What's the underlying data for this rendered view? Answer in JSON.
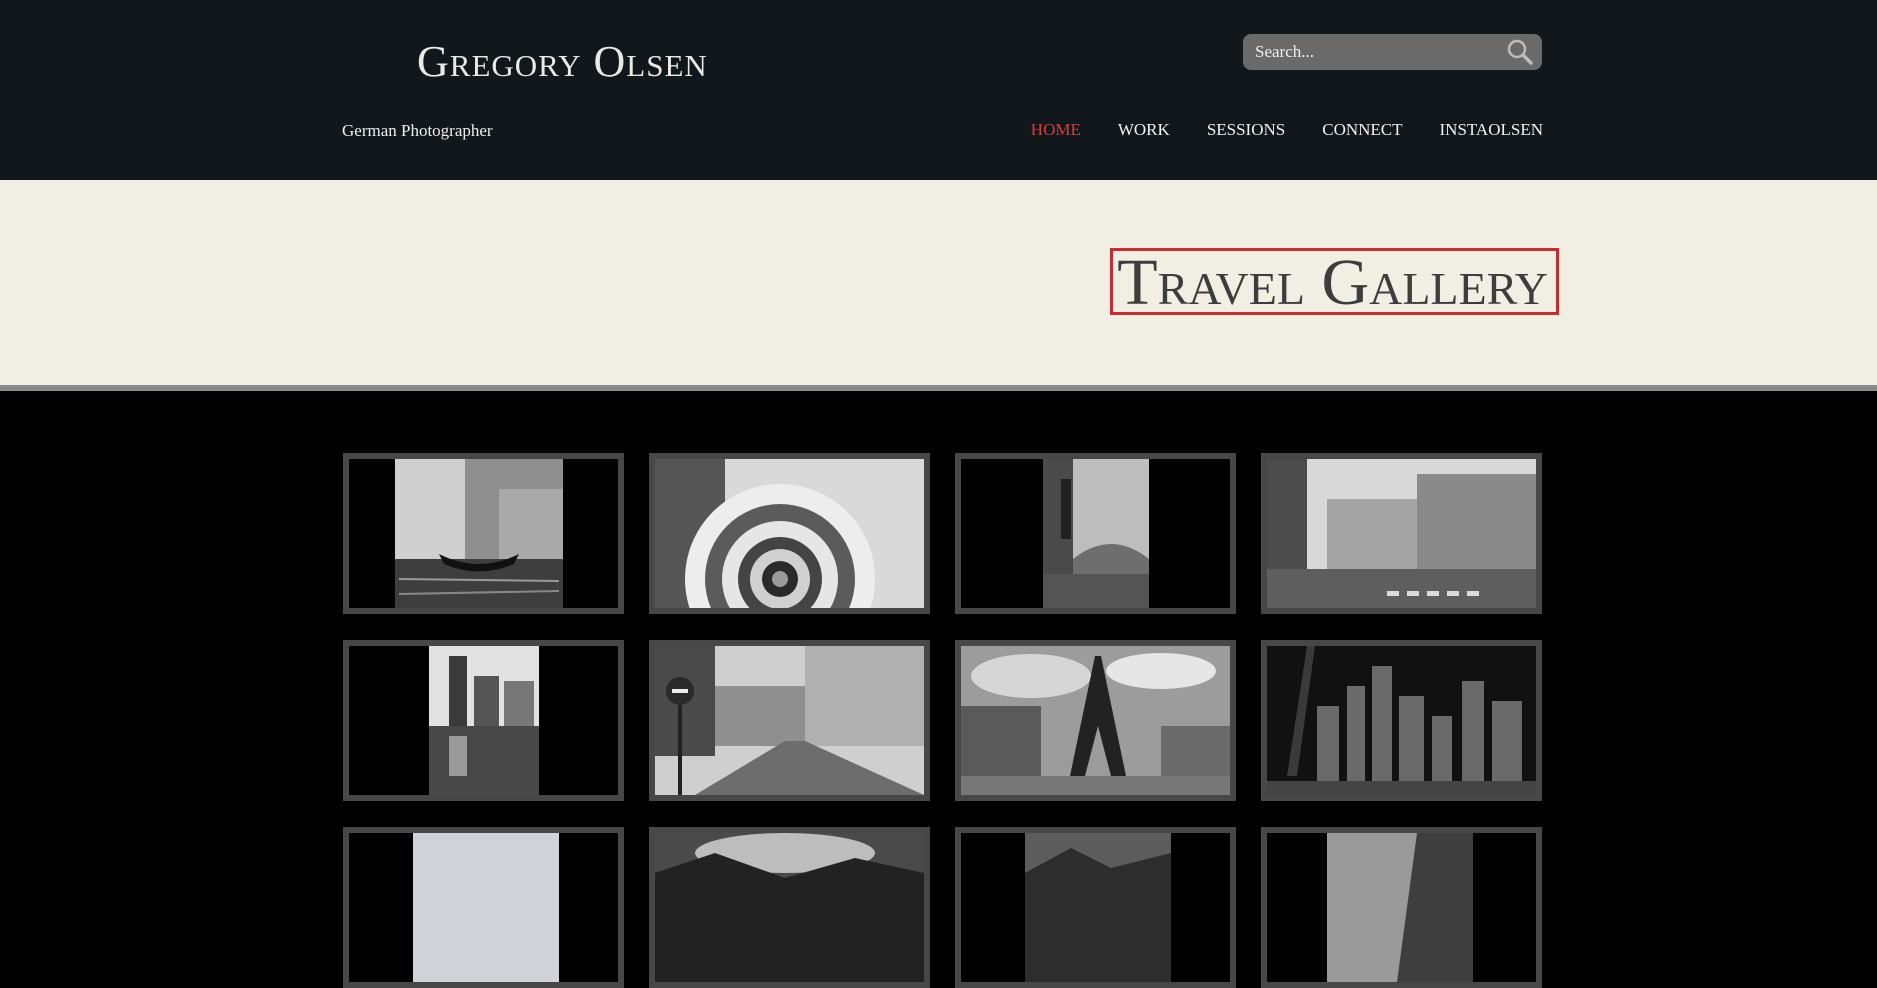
{
  "header": {
    "site_title": "Gregory Olsen",
    "tagline": "German Photographer",
    "search_placeholder": "Search...",
    "nav": [
      {
        "label": "HOME",
        "active": true
      },
      {
        "label": "WORK",
        "active": false
      },
      {
        "label": "SESSIONS",
        "active": false
      },
      {
        "label": "CONNECT",
        "active": false
      },
      {
        "label": "INSTAOLSEN",
        "active": false
      }
    ]
  },
  "banner": {
    "title": "Travel Gallery"
  },
  "gallery": {
    "thumbnails": [
      {
        "subject": "venice-canal-gondola"
      },
      {
        "subject": "spiral-staircase"
      },
      {
        "subject": "paris-bridge-statue"
      },
      {
        "subject": "paris-street-buildings"
      },
      {
        "subject": "skyscrapers-reflection"
      },
      {
        "subject": "paris-street-view"
      },
      {
        "subject": "eiffel-tower"
      },
      {
        "subject": "city-skyline-night"
      },
      {
        "subject": "pale-sky"
      },
      {
        "subject": "clouds-landscape"
      },
      {
        "subject": "mountain-landscape"
      },
      {
        "subject": "rock-landscape"
      }
    ]
  },
  "colors": {
    "header_bg": "#11171a",
    "accent": "#e03a37",
    "banner_bg": "#f1efe3",
    "frame": "#474747"
  }
}
